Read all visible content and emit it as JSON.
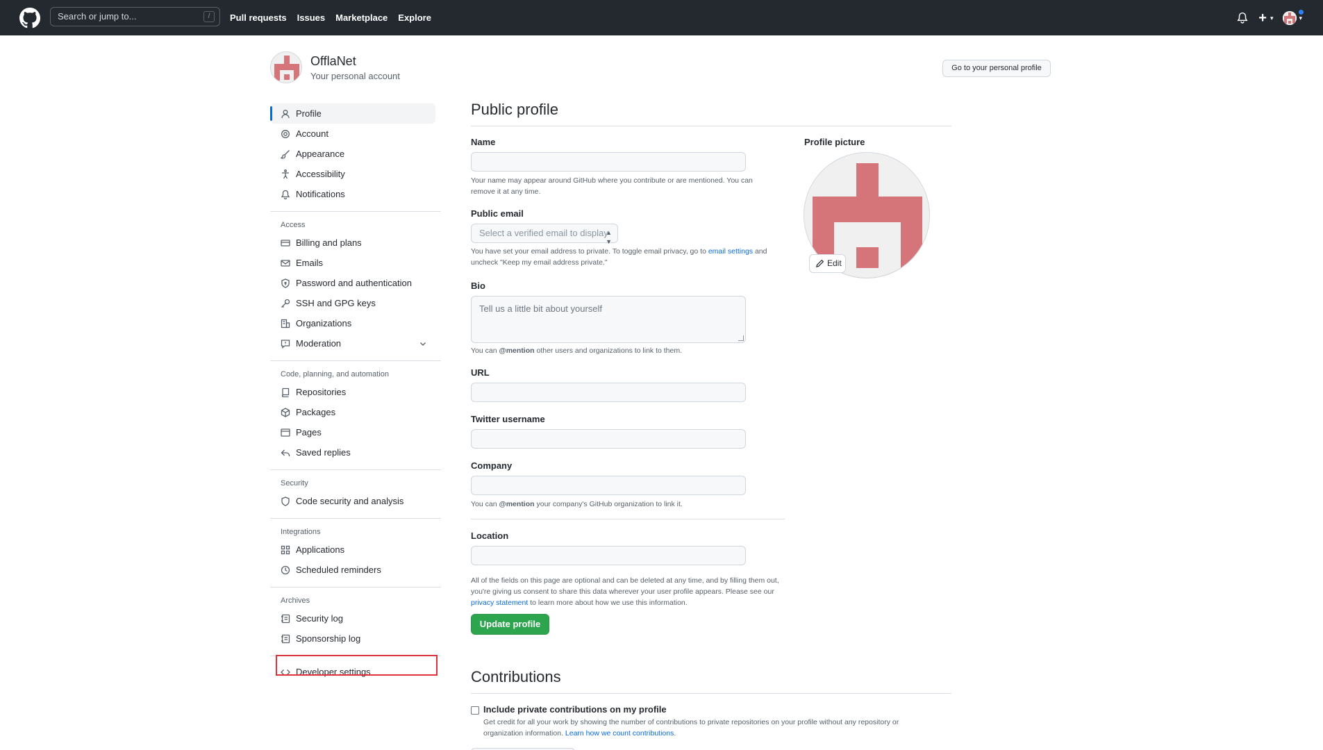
{
  "header": {
    "search_placeholder": "Search or jump to...",
    "search_shortcut": "/",
    "nav": [
      "Pull requests",
      "Issues",
      "Marketplace",
      "Explore"
    ],
    "plus_label": "+"
  },
  "account": {
    "name": "OfflaNet",
    "subtitle": "Your personal account",
    "go_profile_button": "Go to your personal profile"
  },
  "sidebar": {
    "group1": [
      {
        "label": "Profile",
        "icon": "person-icon",
        "active": true
      },
      {
        "label": "Account",
        "icon": "gear-icon"
      },
      {
        "label": "Appearance",
        "icon": "paintbrush-icon"
      },
      {
        "label": "Accessibility",
        "icon": "accessibility-icon"
      },
      {
        "label": "Notifications",
        "icon": "bell-icon"
      }
    ],
    "access_heading": "Access",
    "access": [
      {
        "label": "Billing and plans",
        "icon": "credit-card-icon"
      },
      {
        "label": "Emails",
        "icon": "mail-icon"
      },
      {
        "label": "Password and authentication",
        "icon": "shield-lock-icon"
      },
      {
        "label": "SSH and GPG keys",
        "icon": "key-icon"
      },
      {
        "label": "Organizations",
        "icon": "organization-icon"
      },
      {
        "label": "Moderation",
        "icon": "report-icon"
      }
    ],
    "code_heading": "Code, planning, and automation",
    "code": [
      {
        "label": "Repositories",
        "icon": "repo-icon"
      },
      {
        "label": "Packages",
        "icon": "package-icon"
      },
      {
        "label": "Pages",
        "icon": "browser-icon"
      },
      {
        "label": "Saved replies",
        "icon": "reply-icon"
      }
    ],
    "security_heading": "Security",
    "security": [
      {
        "label": "Code security and analysis",
        "icon": "shield-icon"
      }
    ],
    "integrations_heading": "Integrations",
    "integrations": [
      {
        "label": "Applications",
        "icon": "apps-icon"
      },
      {
        "label": "Scheduled reminders",
        "icon": "clock-icon"
      }
    ],
    "archives_heading": "Archives",
    "archives": [
      {
        "label": "Security log",
        "icon": "log-icon"
      },
      {
        "label": "Sponsorship log",
        "icon": "log-icon"
      }
    ],
    "developer": {
      "label": "Developer settings",
      "icon": "code-icon"
    }
  },
  "main": {
    "public_profile_title": "Public profile",
    "name_label": "Name",
    "name_value": "",
    "name_note": "Your name may appear around GitHub where you contribute or are mentioned. You can remove it at any time.",
    "public_email_label": "Public email",
    "public_email_select": "Select a verified email to display",
    "email_note_pre": "You have set your email address to private. To toggle email privacy, go to ",
    "email_note_link": "email settings",
    "email_note_post": " and uncheck \"Keep my email address private.\"",
    "bio_label": "Bio",
    "bio_placeholder": "Tell us a little bit about yourself",
    "bio_note_pre": "You can ",
    "bio_note_mention": "@mention",
    "bio_note_post": " other users and organizations to link to them.",
    "url_label": "URL",
    "twitter_label": "Twitter username",
    "company_label": "Company",
    "company_note_pre": "You can ",
    "company_note_mention": "@mention",
    "company_note_post": " your company's GitHub organization to link it.",
    "location_label": "Location",
    "consent_note_pre": "All of the fields on this page are optional and can be deleted at any time, and by filling them out, you're giving us consent to share this data wherever your user profile appears. Please see our ",
    "consent_note_link": "privacy statement",
    "consent_note_post": " to learn more about how we use this information.",
    "update_button": "Update profile",
    "profile_picture_label": "Profile picture",
    "edit_button": "Edit",
    "contributions_title": "Contributions",
    "private_contrib_label": "Include private contributions on my profile",
    "private_contrib_note_pre": "Get credit for all your work by showing the number of contributions to private repositories on your profile without any repository or organization information. ",
    "private_contrib_note_link": "Learn how we count contributions",
    "private_contrib_note_post": "."
  },
  "colors": {
    "header_bg": "#24292f",
    "accent_blue": "#0969da",
    "green_button": "#2da44e",
    "avatar_pink": "#d57479",
    "highlight_red": "#e0313d"
  }
}
